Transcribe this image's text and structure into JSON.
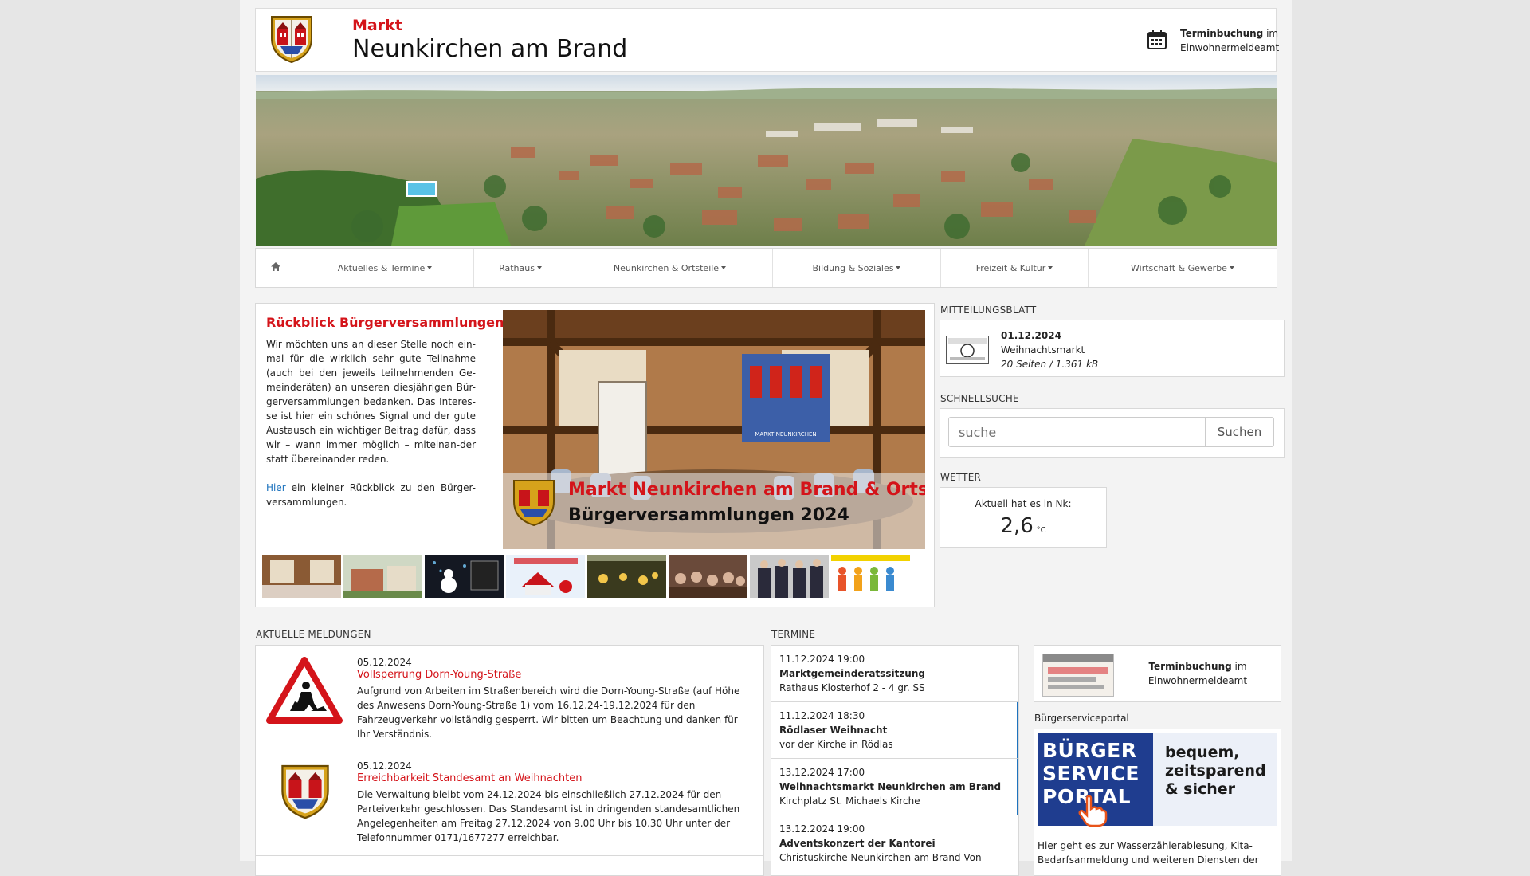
{
  "header": {
    "brand_small": "Markt",
    "brand_big": "Neunkirchen am Brand",
    "appointment_bold": "Terminbuchung",
    "appointment_rest": " im",
    "appointment_line2": "Einwohnermeldeamt"
  },
  "nav": {
    "items": [
      {
        "label": "Aktuelles & Termine"
      },
      {
        "label": "Rathaus"
      },
      {
        "label": "Neunkirchen & Ortsteile"
      },
      {
        "label": "Bildung & Soziales"
      },
      {
        "label": "Freizeit & Kultur"
      },
      {
        "label": "Wirtschaft & Gewerbe"
      }
    ]
  },
  "feature": {
    "title": "Rückblick Bürgerversammlungen",
    "body": "Wir möchten uns an dieser Stelle noch ein-mal für die wirklich sehr gute Teilnahme (auch bei den jeweils teilnehmenden Ge-meinderäten) an unseren diesjährigen Bür-gerversammlungen bedanken. Das Interes-se ist hier ein schönes Signal und der gute Austausch ein wichtiger Beitrag dafür, dass wir – wann immer möglich – miteinan-der statt übereinander reden.",
    "link": "Hier",
    "link_rest": " ein kleiner Rückblick zu den Bürger-versammlungen.",
    "image_line1": "Markt Neunkirchen am Brand & Ortsteile",
    "image_line2": "Bürgerversammlungen 2024",
    "image_poster": "MARKT NEUNKIRCHEN"
  },
  "mitteilungsblatt": {
    "label": "MITTEILUNGSBLATT",
    "date": "01.12.2024",
    "title": "Weihnachtsmarkt",
    "meta": "20 Seiten / 1.361 kB"
  },
  "schnellsuche": {
    "label": "SCHNELLSUCHE",
    "placeholder": "suche",
    "button": "Suchen"
  },
  "wetter": {
    "label": "WETTER",
    "text": "Aktuell hat es in Nk:",
    "value": "2,6",
    "unit": "°C"
  },
  "meldungen": {
    "label": "AKTUELLE MELDUNGEN",
    "items": [
      {
        "date": "05.12.2024",
        "title": "Vollsperrung Dorn-Young-Straße",
        "text": "Aufgrund von Arbeiten im Straßenbereich wird die Dorn-Young-Straße (auf Höhe des Anwesens Dorn-Young-Straße 1) vom 16.12.24-19.12.2024 für den Fahrzeugverkehr vollständig gesperrt. Wir bitten um Beachtung und danken für Ihr Verständnis."
      },
      {
        "date": "05.12.2024",
        "title": "Erreichbarkeit Standesamt an Weihnachten",
        "text": "Die Verwaltung bleibt vom 24.12.2024 bis einschließlich 27.12.2024 für den Parteiverkehr geschlossen. Das Standesamt ist in dringenden standesamtlichen Angelegenheiten am Freitag 27.12.2024 von 9.00 Uhr bis 10.30 Uhr unter der Telefonnummer 0171/1677277 erreichbar."
      }
    ]
  },
  "termine": {
    "label": "TERMINE",
    "items": [
      {
        "date": "11.12.2024 19:00",
        "title": "Marktgemeinderatssitzung",
        "place": "Rathaus Klosterhof 2 - 4 gr. SS"
      },
      {
        "date": "11.12.2024 18:30",
        "title": "Rödlaser Weihnacht",
        "place": "vor der Kirche in Rödlas"
      },
      {
        "date": "13.12.2024 17:00",
        "title": "Weihnachtsmarkt Neunkirchen am Brand",
        "place": "Kirchplatz St. Michaels Kirche"
      },
      {
        "date": "13.12.2024 19:00",
        "title": "Adventskonzert der Kantorei",
        "place": "Christuskirche Neunkirchen am Brand Von-"
      }
    ]
  },
  "sidebar": {
    "appointment_bold": "Terminbuchung",
    "appointment_rest": " im",
    "appointment_line2": "Einwohnermeldeamt",
    "portal_label": "Bürgerserviceportal",
    "portal_logo_line1": "BÜRGER",
    "portal_logo_line2": "SERVICE",
    "portal_logo_line3": "PORTAL",
    "portal_slogan_1": "bequem,",
    "portal_slogan_2": "zeitsparend",
    "portal_slogan_3": "& sicher",
    "portal_text_1": "Hier geht es zur Wasserzählerablesung, Kita-",
    "portal_text_2": "Bedarfsanmeldung und weiteren Diensten der"
  },
  "colors": {
    "brand_red": "#d4141a",
    "link_blue": "#1e73be",
    "portal_blue": "#1f3d8f"
  }
}
